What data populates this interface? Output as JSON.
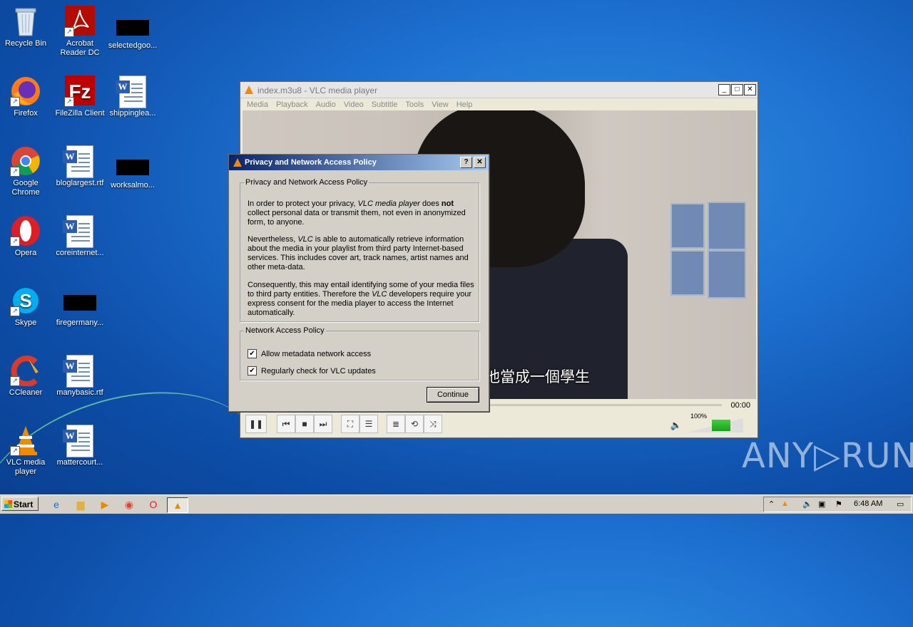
{
  "desktop_icons": [
    {
      "label": "Recycle Bin",
      "icon": "recycle-bin-icon"
    },
    {
      "label": "Acrobat\nReader DC",
      "icon": "acrobat-icon"
    },
    {
      "label": "selectedgoo...",
      "icon": "black-file-icon"
    },
    {
      "label": "Firefox",
      "icon": "firefox-icon"
    },
    {
      "label": "FileZilla Client",
      "icon": "filezilla-icon"
    },
    {
      "label": "shippinglea...",
      "icon": "word-doc-icon"
    },
    {
      "label": "Google\nChrome",
      "icon": "chrome-icon"
    },
    {
      "label": "bloglargest.rtf",
      "icon": "word-doc-icon"
    },
    {
      "label": "worksalmo...",
      "icon": "black-file-icon"
    },
    {
      "label": "Opera",
      "icon": "opera-icon"
    },
    {
      "label": "coreinternet...",
      "icon": "word-doc-icon"
    },
    {
      "label": "Skype",
      "icon": "skype-icon"
    },
    {
      "label": "firegermany...",
      "icon": "black-file-icon"
    },
    {
      "label": "CCleaner",
      "icon": "ccleaner-icon"
    },
    {
      "label": "manybasic.rtf",
      "icon": "word-doc-icon"
    },
    {
      "label": "VLC media\nplayer",
      "icon": "vlc-icon"
    },
    {
      "label": "mattercourt...",
      "icon": "word-doc-icon"
    }
  ],
  "vlc": {
    "title": "index.m3u8 - VLC media player",
    "menu": [
      "Media",
      "Playback",
      "Audio",
      "Video",
      "Subtitle",
      "Tools",
      "View",
      "Help"
    ],
    "subtitle_text": "他當成一個學生",
    "time": "00:00",
    "volume": "100%",
    "volume_level": 1.0
  },
  "dialog": {
    "title": "Privacy and Network Access Policy",
    "help_btn": "?",
    "close_btn": "✕",
    "group1_title": "Privacy and Network Access Policy",
    "p1_a": "In order to protect your privacy, ",
    "p1_b": "VLC media player",
    "p1_c": " does ",
    "p1_d": "not",
    "p1_e": " collect personal data or transmit them, not even in anonymized form, to anyone.",
    "p2_a": "Nevertheless, ",
    "p2_b": "VLC",
    "p2_c": " is able to automatically retrieve information about the media in your playlist from third party Internet-based services. This includes cover art, track names, artist names and other meta-data.",
    "p3_a": "Consequently, this may entail identifying some of your media files to third party entities. Therefore the ",
    "p3_b": "VLC",
    "p3_c": " developers require your express consent for the media player to access the Internet automatically.",
    "group2_title": "Network Access Policy",
    "chk1": "Allow metadata network access",
    "chk2": "Regularly check for VLC updates",
    "continue": "Continue"
  },
  "watermark": "ANY▷RUN",
  "taskbar": {
    "start": "Start",
    "clock": "6:48 AM"
  }
}
